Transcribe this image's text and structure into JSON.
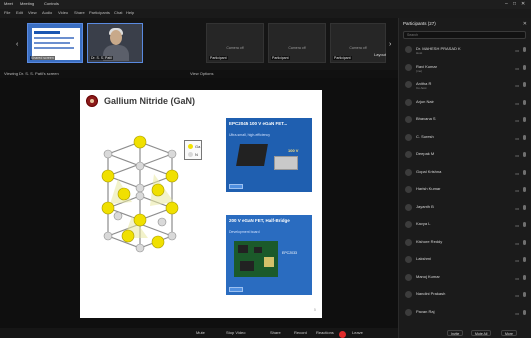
{
  "window": {
    "menu_top": [
      "Meet",
      "Meeting",
      "Controls"
    ],
    "menu_second": [
      "File",
      "Edit",
      "View",
      "Audio",
      "Video",
      "Share",
      "Participants",
      "Chat",
      "Help"
    ],
    "window_controls": [
      "–",
      "□",
      "✕"
    ]
  },
  "video_strip": {
    "slide_tile_label": "Shared screen",
    "cam_tile_name": "Dr. S. S. Patil",
    "tiles": [
      {
        "label": "Camera off",
        "name": "Participant"
      },
      {
        "label": "Camera off",
        "name": "Participant"
      },
      {
        "label": "Camera off",
        "name": "Participant"
      }
    ],
    "layout_btn": "Layout"
  },
  "share_bar": {
    "left_text": "Viewing Dr. S. S. Patil's screen",
    "center_text": "View Options"
  },
  "slide": {
    "title": "Gallium Nitride (GaN)",
    "legend": [
      {
        "label": "Ga",
        "color": "#f2e200"
      },
      {
        "label": "N",
        "color": "#d8d8d8"
      }
    ],
    "product1": {
      "title": "EPC2045 100 V eGaN FET...",
      "subtitle": "Ultra-small, high-efficiency",
      "tag": "100 V"
    },
    "product2": {
      "title": "200 V eGaN FET, Half-Bridge",
      "subtitle": "Development board",
      "note": "EPC2033"
    },
    "page_number": "5"
  },
  "controls": {
    "items": [
      "Mute",
      "Stop Video",
      "Share",
      "Record",
      "Reactions",
      "Leave"
    ]
  },
  "participants": {
    "header": "Participants (27)",
    "search_placeholder": "Search",
    "rows": [
      {
        "name": "Dr. MAHESH PRASAD K",
        "role": "Host"
      },
      {
        "name": "Ravi Kumar",
        "role": "(me)"
      },
      {
        "name": "Anitha R",
        "role": "Co-host"
      },
      {
        "name": "Arjun Nair",
        "role": ""
      },
      {
        "name": "Bhavana S",
        "role": ""
      },
      {
        "name": "C. Suresh",
        "role": ""
      },
      {
        "name": "Deepak M",
        "role": ""
      },
      {
        "name": "Gopal Krishna",
        "role": ""
      },
      {
        "name": "Harish Kumar",
        "role": ""
      },
      {
        "name": "Jayanth B",
        "role": ""
      },
      {
        "name": "Kavya L",
        "role": ""
      },
      {
        "name": "Kishore Reddy",
        "role": ""
      },
      {
        "name": "Lakshmi",
        "role": ""
      },
      {
        "name": "Manoj Kumar",
        "role": ""
      },
      {
        "name": "Nandini Prakash",
        "role": ""
      },
      {
        "name": "Pavan Raj",
        "role": ""
      }
    ],
    "footer_buttons": [
      "Invite",
      "Mute All",
      "More"
    ]
  }
}
